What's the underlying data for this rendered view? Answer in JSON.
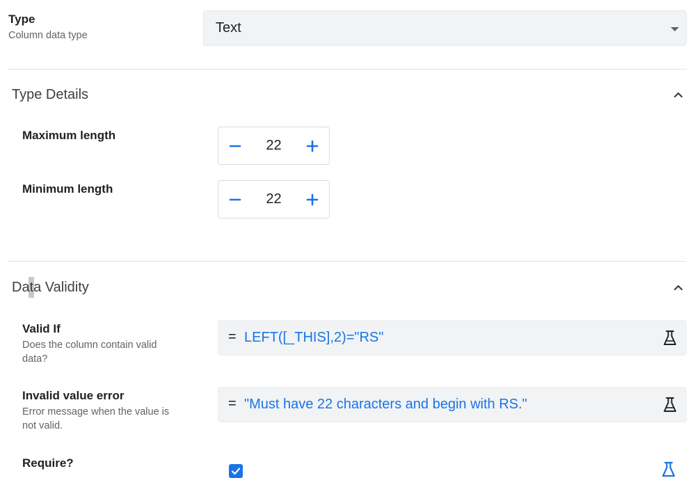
{
  "type_field": {
    "label": "Type",
    "description": "Column data type",
    "selected_value": "Text"
  },
  "type_details": {
    "title": "Type Details",
    "max_length": {
      "label": "Maximum length",
      "value": "22"
    },
    "min_length": {
      "label": "Minimum length",
      "value": "22"
    }
  },
  "data_validity": {
    "title": "Data Validity",
    "valid_if": {
      "label": "Valid If",
      "description_line1": "Does the column contain valid",
      "description_line2": "data?",
      "operator": "=",
      "expression": "LEFT([_THIS],2)=\"RS\""
    },
    "invalid_value_error": {
      "label": "Invalid value error",
      "description_line1": "Error message when the value is",
      "description_line2": "not valid.",
      "operator": "=",
      "expression": "\"Must have 22 characters and begin with RS.\""
    },
    "require": {
      "label": "Require?",
      "checked": true
    }
  },
  "colors": {
    "accent": "#1a73e8",
    "field_bg": "#f1f3f4",
    "divider": "#e0e0e0"
  },
  "icons": {
    "dropdown": "caret-down-icon",
    "collapse": "chevron-up-icon",
    "decrement": "minus-icon",
    "increment": "plus-icon",
    "expression_test": "flask-icon",
    "checkbox": "checkmark-icon"
  }
}
